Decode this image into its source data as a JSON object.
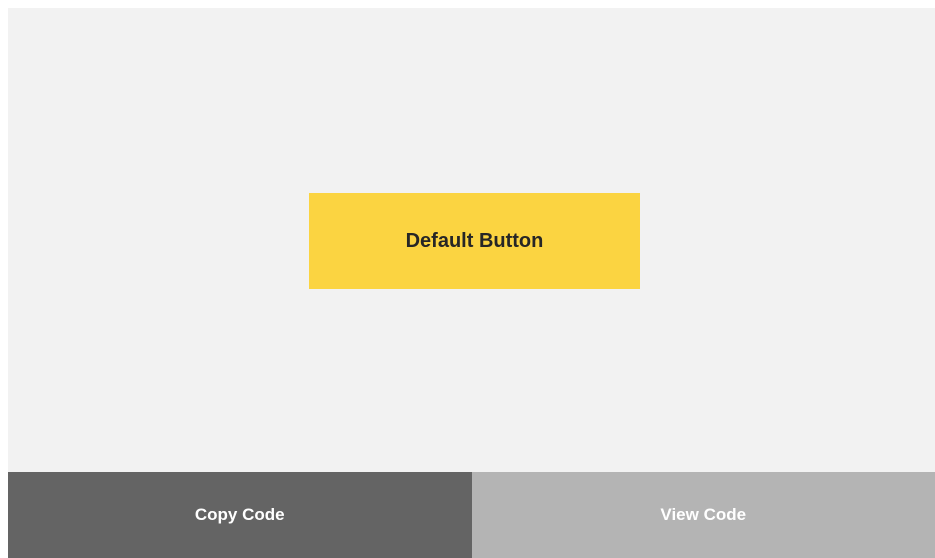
{
  "preview": {
    "button_label": "Default Button",
    "button_color": "#fbd441"
  },
  "footer": {
    "copy_label": "Copy Code",
    "view_label": "View Code",
    "copy_color": "#646464",
    "view_color": "#b4b4b4"
  }
}
